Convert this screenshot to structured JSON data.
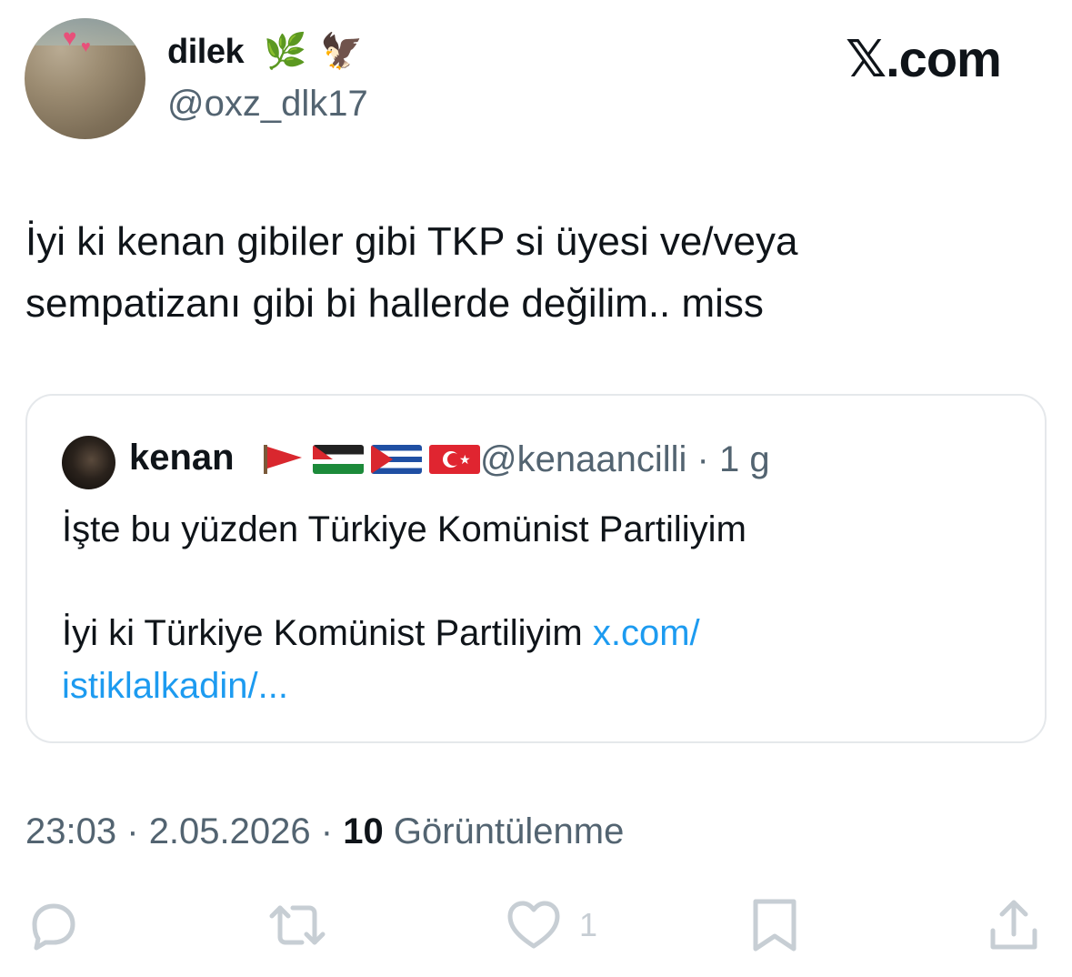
{
  "author": {
    "display_name": "dilek",
    "name_emojis": [
      "🌿",
      "🦅"
    ],
    "handle": "@oxz_dlk17"
  },
  "brand": {
    "logo_mark": "𝕏",
    "logo_text": ".com"
  },
  "tweet": {
    "text_line1": "İyi ki kenan gibiler gibi TKP si üyesi ve/veya",
    "text_line2": "sempatizanı gibi bi hallerde değilim.. miss"
  },
  "quote": {
    "display_name": "kenan",
    "flags": [
      "red-flag",
      "palestine-flag",
      "cuba-flag",
      "turkey-flag"
    ],
    "handle": "@kenaancilli",
    "separator": "·",
    "age": "1 g",
    "text_line1": "İşte bu yüzden Türkiye Komünist Partiliyim",
    "text_line2": "İyi ki Türkiye Komünist Partiliyim ",
    "link_part1": "x.com/",
    "link_part2": "istiklalkadin/..."
  },
  "meta": {
    "time": "23:03",
    "sep1": "·",
    "date": "2.05.2026",
    "sep2": "·",
    "views_count": "10",
    "views_label": "Görüntülenme"
  },
  "actions": {
    "reply_icon": "reply-icon",
    "retweet_icon": "retweet-icon",
    "like_icon": "heart-icon",
    "like_count": "1",
    "bookmark_icon": "bookmark-icon",
    "share_icon": "share-icon"
  },
  "colors": {
    "text": "#0f1419",
    "secondary": "#536471",
    "link": "#1d9bf0",
    "border": "#e5e8eb",
    "action_icon": "#c7ced4"
  }
}
